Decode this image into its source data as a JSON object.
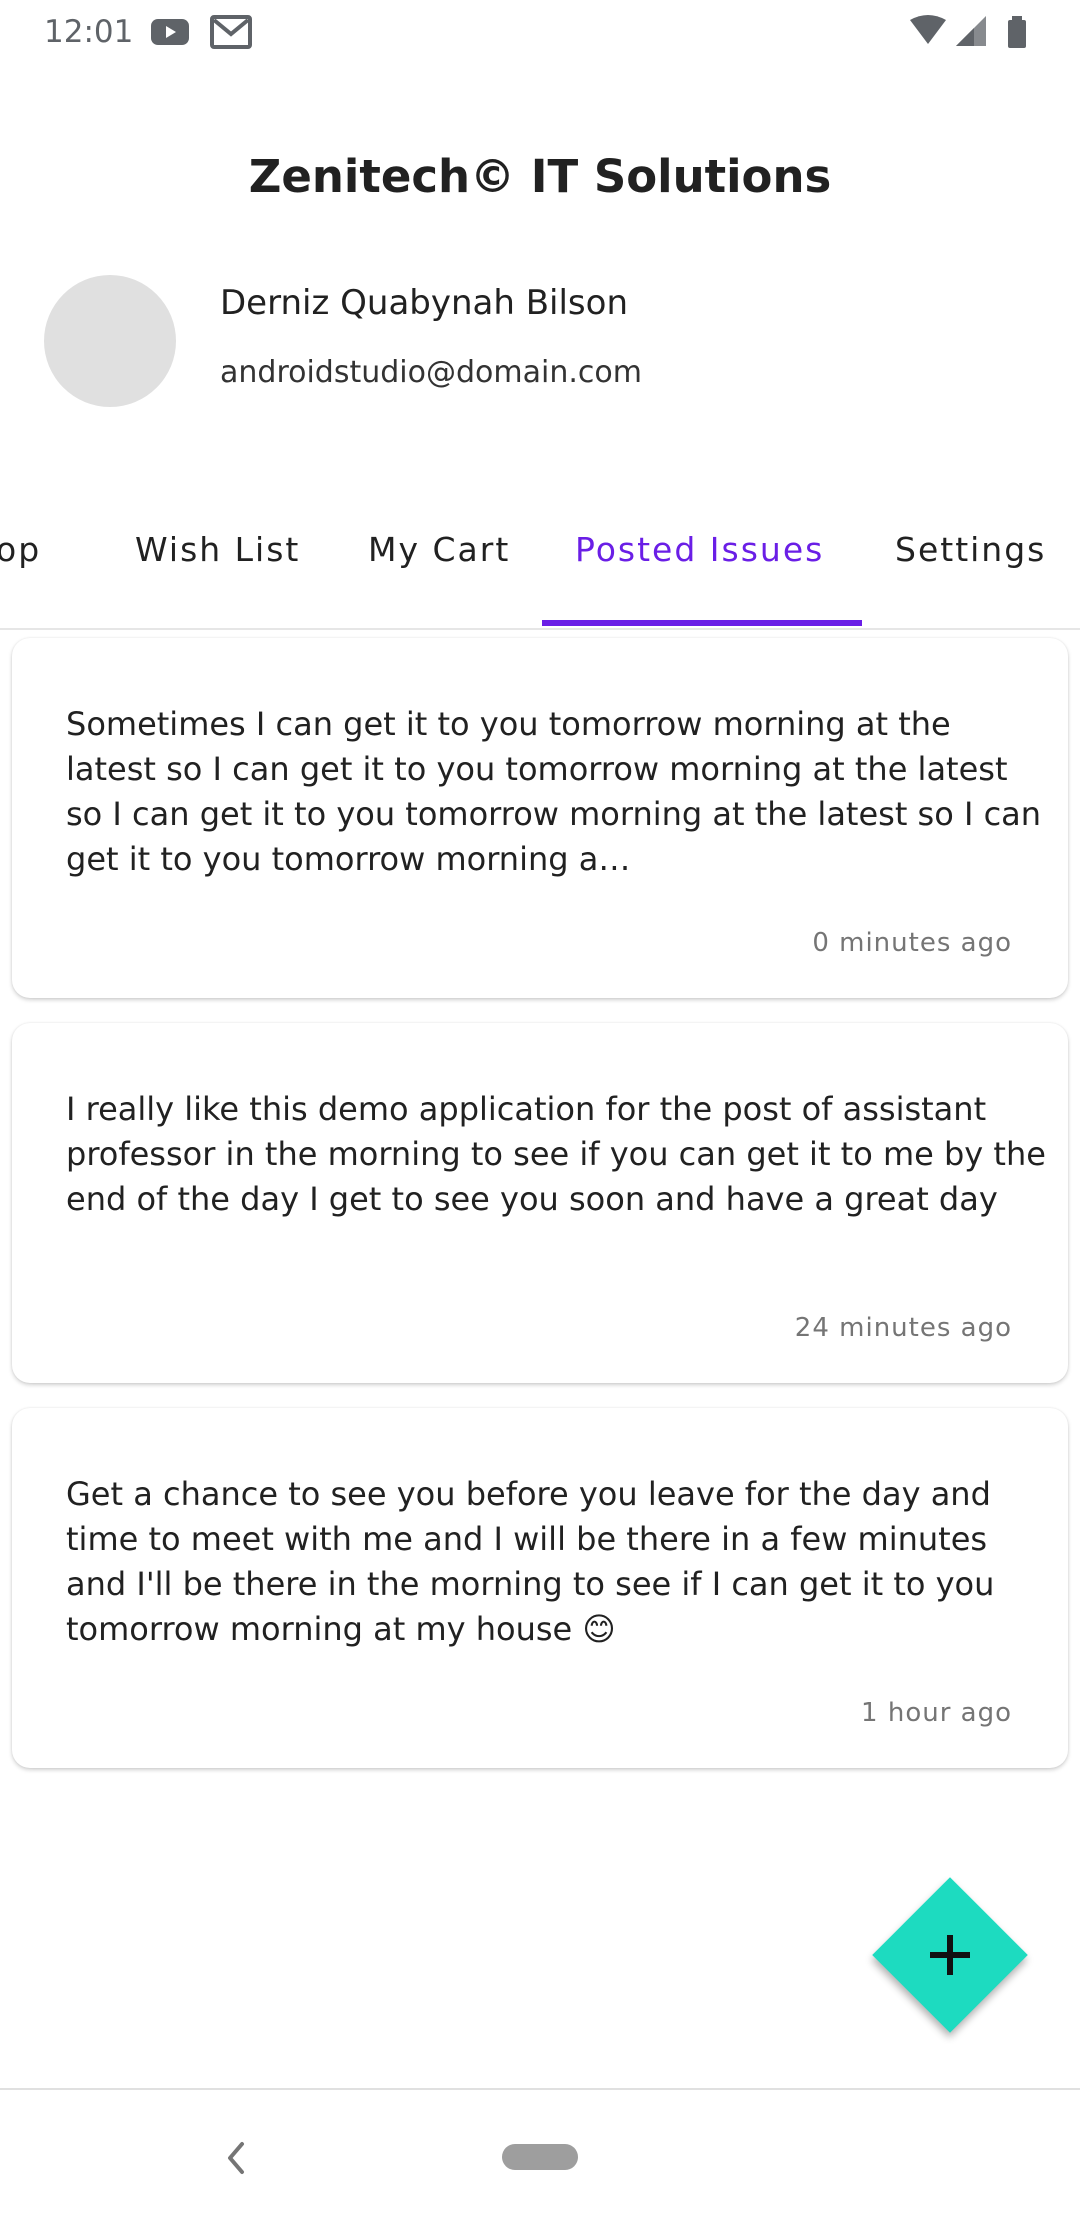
{
  "status_bar": {
    "time": "12:01",
    "icons": [
      "youtube-icon",
      "gmail-icon",
      "wifi-icon",
      "signal-icon",
      "battery-icon"
    ]
  },
  "header": {
    "title": "Zenitech© IT Solutions",
    "user_name": "Derniz Quabynah Bilson",
    "user_email": "androidstudio@domain.com"
  },
  "tabs": [
    {
      "label": "op",
      "active": false
    },
    {
      "label": "Wish List",
      "active": false
    },
    {
      "label": "My Cart",
      "active": false
    },
    {
      "label": "Posted Issues",
      "active": true
    },
    {
      "label": "Settings",
      "active": false
    }
  ],
  "issues": [
    {
      "text": "Sometimes I can get it to you tomorrow morning at the latest so I can get it to you tomorrow morning at the latest so I can get it to you tomorrow morning at the latest so I can get it to you tomorrow morning a…",
      "time": "0 minutes ago"
    },
    {
      "text": "I really like this demo application for the post of assistant professor in the morning to see if you can get it to me by the end of the day I get to see you soon and have a great day",
      "time": "24 minutes ago"
    },
    {
      "text": "Get a chance to see you before you leave for the day and time to meet with me and I will be there in a few minutes and I'll be there in the morning to see if I can get it to you tomorrow morning at my house 😊",
      "time": "1 hour ago"
    }
  ],
  "fab": {
    "icon": "plus-icon"
  },
  "colors": {
    "accent": "#6a1ee6",
    "fab": "#1ddbc0",
    "avatar_placeholder": "#e0e0e0"
  }
}
